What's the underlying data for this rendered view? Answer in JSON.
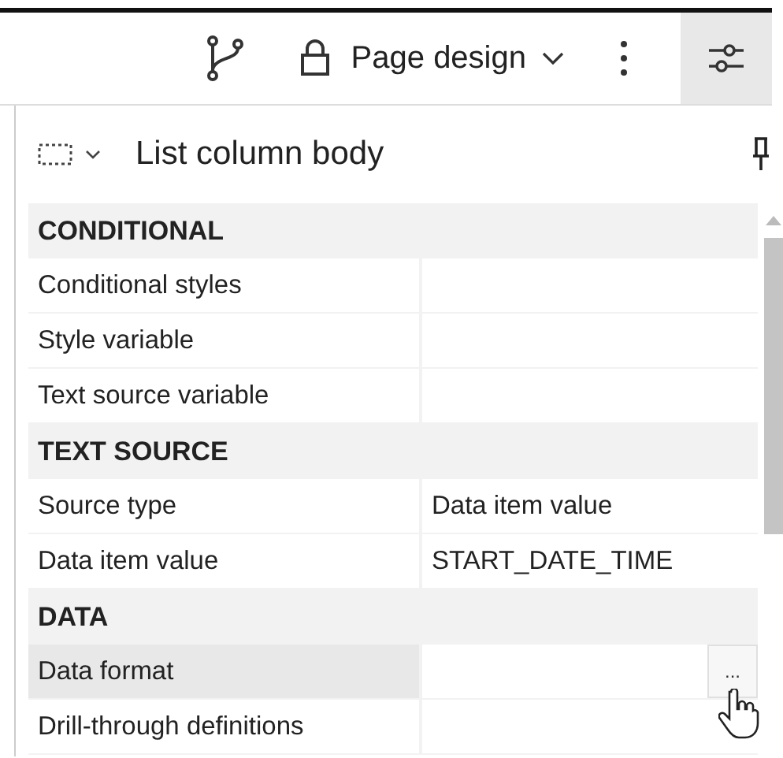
{
  "toolbar": {
    "view_menu": "Page design",
    "properties_toggle_on": true
  },
  "panel": {
    "title": "List column body",
    "sections": [
      {
        "heading": "CONDITIONAL",
        "rows": [
          {
            "label": "Conditional styles",
            "value": "",
            "selected": false
          },
          {
            "label": "Style variable",
            "value": "",
            "selected": false
          },
          {
            "label": "Text source variable",
            "value": "",
            "selected": false
          }
        ]
      },
      {
        "heading": "TEXT SOURCE",
        "rows": [
          {
            "label": "Source type",
            "value": "Data item value",
            "selected": false
          },
          {
            "label": "Data item value",
            "value": "START_DATE_TIME",
            "selected": false
          }
        ]
      },
      {
        "heading": "DATA",
        "rows": [
          {
            "label": "Data format",
            "value": "",
            "selected": true,
            "button": "..."
          },
          {
            "label": "Drill-through definitions",
            "value": "",
            "selected": false
          }
        ]
      }
    ]
  }
}
